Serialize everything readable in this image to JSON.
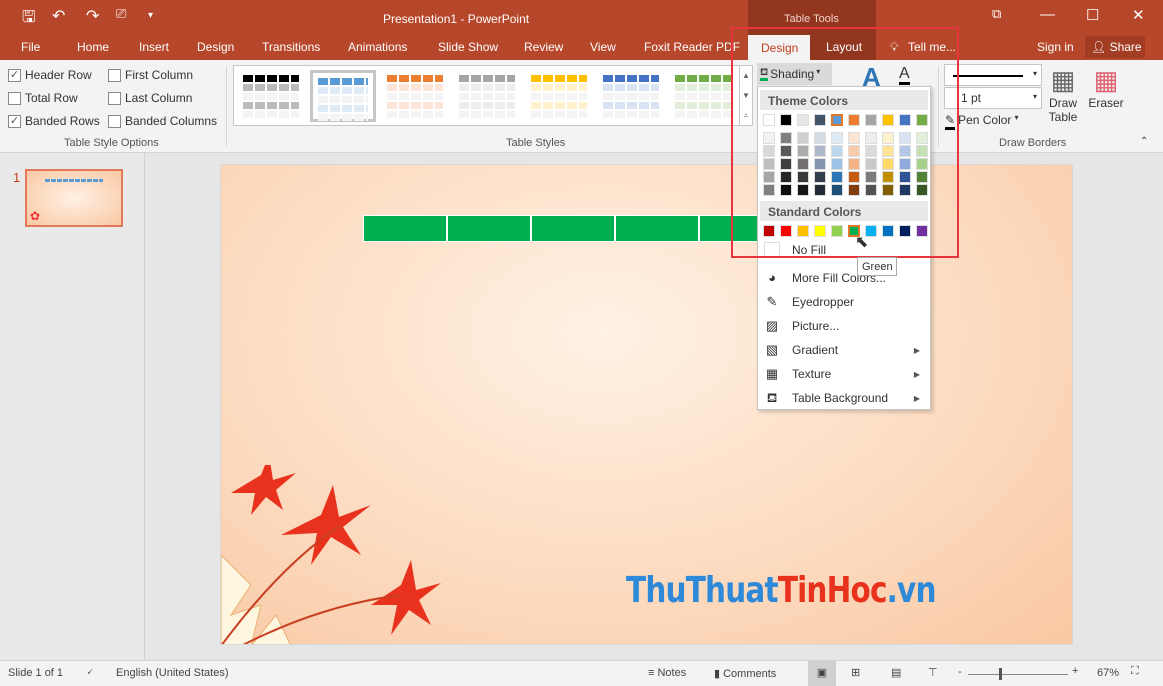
{
  "app": {
    "title": "Presentation1 - PowerPoint",
    "context_tab_group": "Table Tools"
  },
  "tabs": [
    "File",
    "Home",
    "Insert",
    "Design",
    "Transitions",
    "Animations",
    "Slide Show",
    "Review",
    "View",
    "Foxit Reader PDF"
  ],
  "context_tabs": {
    "design": "Design",
    "layout": "Layout"
  },
  "tell_me": "Tell me...",
  "sign_in": "Sign in",
  "share": "Share",
  "table_style_options": {
    "group_label": "Table Style Options",
    "items": [
      {
        "label": "Header Row",
        "checked": true
      },
      {
        "label": "First Column",
        "checked": false
      },
      {
        "label": "Total Row",
        "checked": false
      },
      {
        "label": "Last Column",
        "checked": false
      },
      {
        "label": "Banded Rows",
        "checked": true
      },
      {
        "label": "Banded Columns",
        "checked": false
      }
    ]
  },
  "table_styles": {
    "group_label": "Table Styles",
    "styles": [
      "#000000",
      "#5b9bd5",
      "#ed7d31",
      "#a5a5a5",
      "#ffc000",
      "#4472c4",
      "#70ad47"
    ]
  },
  "shading": {
    "label": "Shading",
    "accent": "#00b050"
  },
  "draw_borders": {
    "group_label": "Draw Borders",
    "weight": "1 pt",
    "pen_color": "Pen Color",
    "draw_table": "Draw Table",
    "eraser": "Eraser"
  },
  "menu": {
    "theme_header": "Theme Colors",
    "standard_header": "Standard Colors",
    "theme_colors": [
      "#ffffff",
      "#000000",
      "#e7e6e6",
      "#44546a",
      "#5b9bd5",
      "#ed7d31",
      "#a5a5a5",
      "#ffc000",
      "#4472c4",
      "#70ad47"
    ],
    "theme_shades": [
      [
        "#f2f2f2",
        "#d9d9d9",
        "#bfbfbf",
        "#a6a6a6",
        "#808080"
      ],
      [
        "#808080",
        "#595959",
        "#404040",
        "#262626",
        "#0d0d0d"
      ],
      [
        "#d0cece",
        "#aeabab",
        "#757070",
        "#3a3838",
        "#171616"
      ],
      [
        "#d6dce4",
        "#adb9ca",
        "#8496b0",
        "#333f4f",
        "#222a35"
      ],
      [
        "#deebf6",
        "#bdd7ee",
        "#9dc3e6",
        "#2e75b5",
        "#1f4e79"
      ],
      [
        "#fbe5d5",
        "#f7cbac",
        "#f4b183",
        "#c55a11",
        "#833c0b"
      ],
      [
        "#ededed",
        "#dbdbdb",
        "#c9c9c9",
        "#7b7b7b",
        "#525252"
      ],
      [
        "#fff2cc",
        "#fee599",
        "#ffd965",
        "#bf9000",
        "#7f6000"
      ],
      [
        "#dae3f3",
        "#b4c7e7",
        "#8faadc",
        "#2f5597",
        "#1f3864"
      ],
      [
        "#e2efd9",
        "#c5e0b3",
        "#a8d08d",
        "#538135",
        "#375623"
      ]
    ],
    "standard_colors": [
      "#c00000",
      "#ff0000",
      "#ffc000",
      "#ffff00",
      "#92d050",
      "#00b050",
      "#00b0f0",
      "#0070c0",
      "#002060",
      "#7030a0"
    ],
    "selected_standard": "Green",
    "no_fill": "No Fill",
    "items": [
      {
        "label": "More Fill Colors...",
        "icon": "palette-icon"
      },
      {
        "label": "Eyedropper",
        "icon": "eyedropper-icon"
      },
      {
        "label": "Picture...",
        "icon": "picture-icon"
      },
      {
        "label": "Gradient",
        "icon": "gradient-icon",
        "submenu": true
      },
      {
        "label": "Texture",
        "icon": "texture-icon",
        "submenu": true
      },
      {
        "label": "Table Background",
        "icon": "paint-bucket-icon",
        "submenu": true
      }
    ]
  },
  "tooltip": "Green",
  "thumbnail": {
    "number": "1"
  },
  "slide": {
    "logo": "ThuThuatTinHoc.vn"
  },
  "status": {
    "slide": "Slide 1 of 1",
    "language": "English (United States)",
    "notes": "Notes",
    "comments": "Comments",
    "zoom": "67%"
  }
}
